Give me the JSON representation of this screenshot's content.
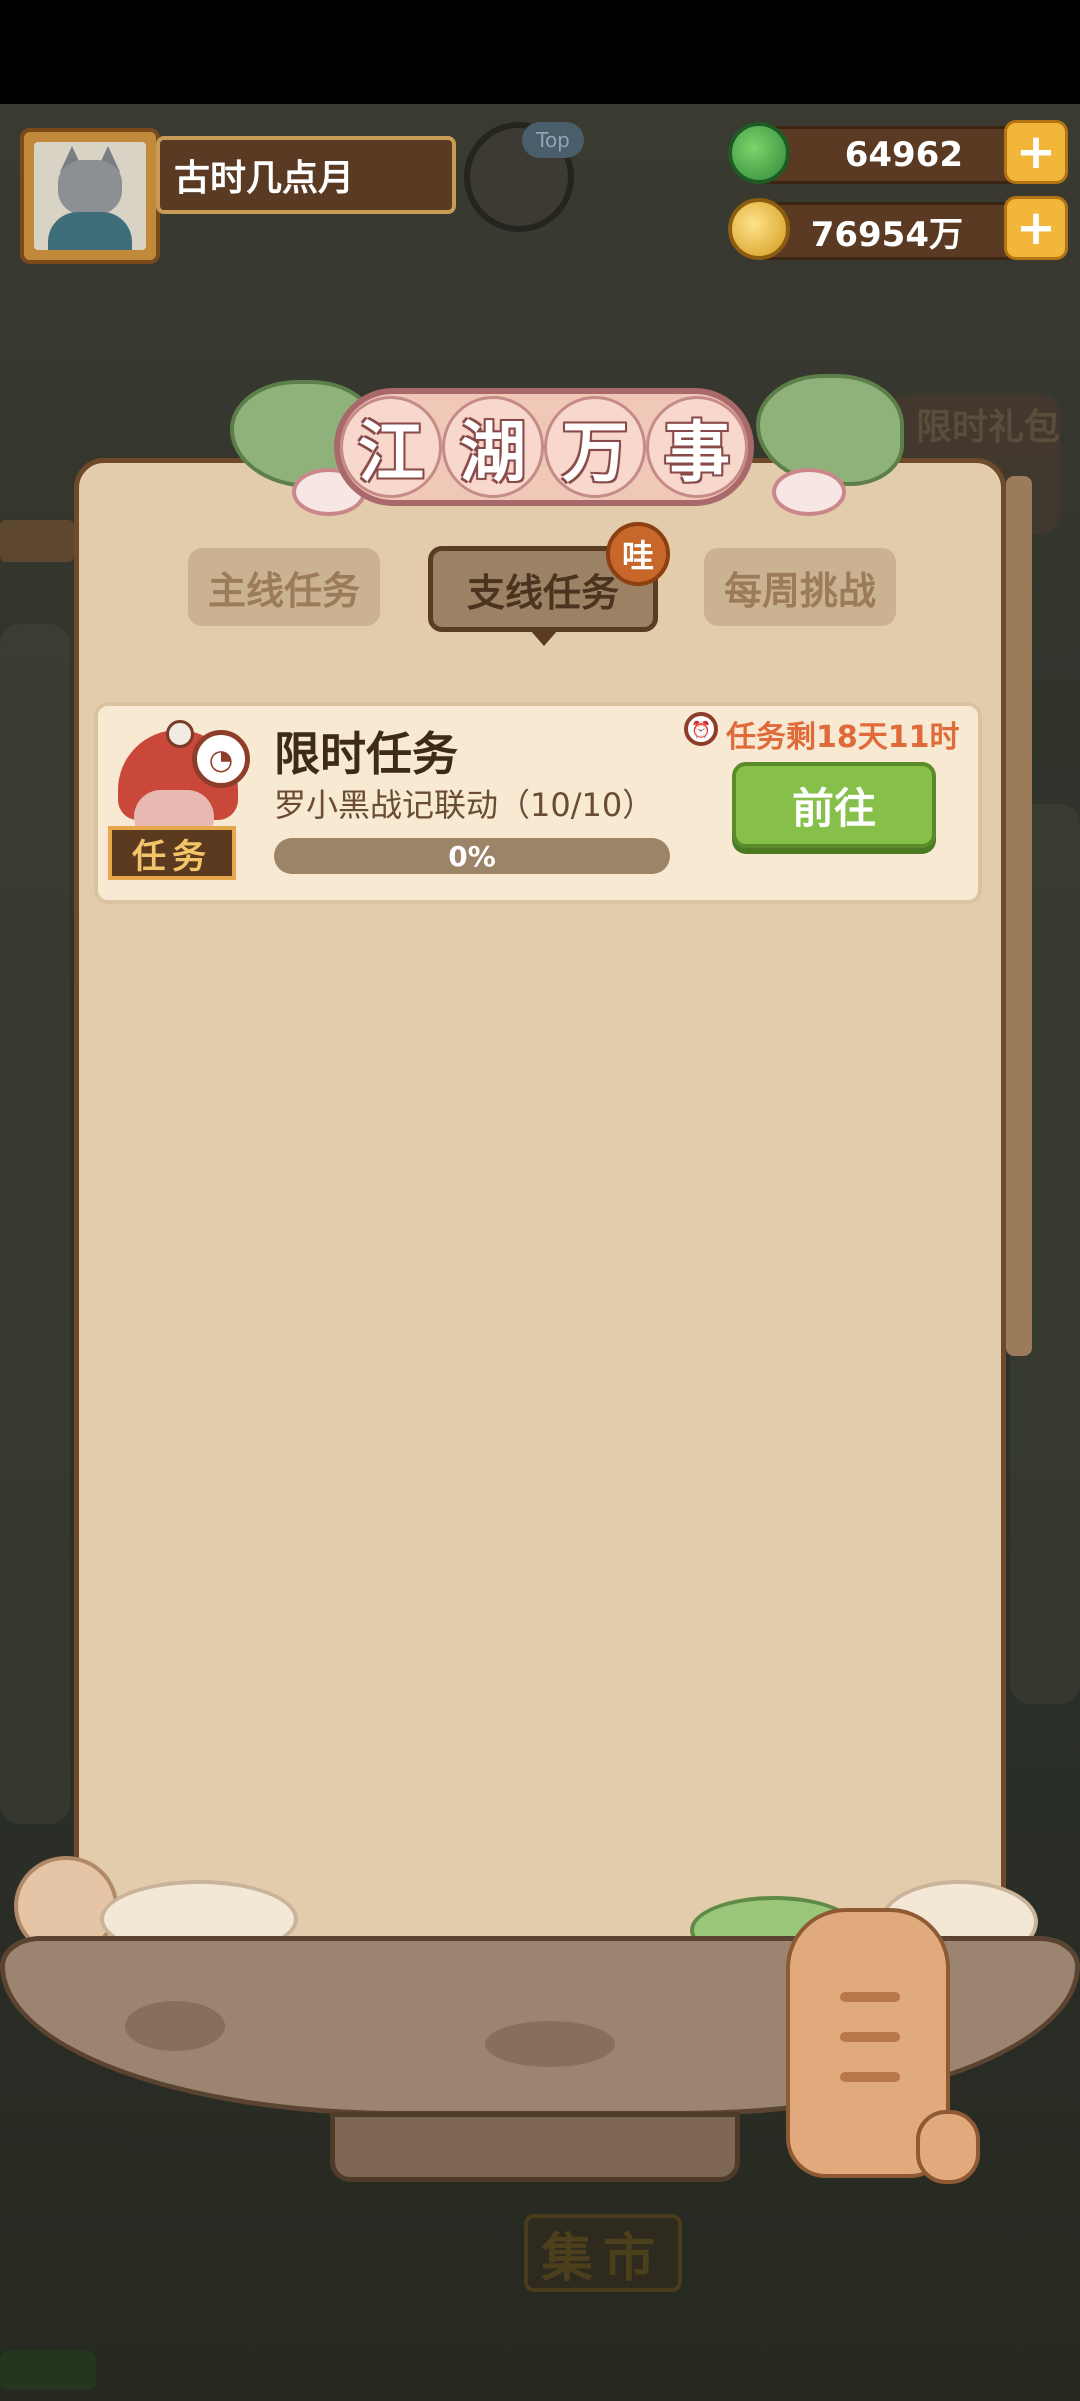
{
  "hud": {
    "player_name": "古时几点月",
    "top_badge": "Top",
    "resources": [
      {
        "icon": "jade-coin-icon",
        "value": "64962"
      },
      {
        "icon": "gold-coin-icon",
        "value": "76954万"
      }
    ],
    "plus_label": "+"
  },
  "background": {
    "gift_label": "限时礼包",
    "market_label": "集市"
  },
  "panel": {
    "title_chars": [
      "江",
      "湖",
      "万",
      "事"
    ],
    "tabs": [
      {
        "label": "主线任务",
        "active": false
      },
      {
        "label": "支线任务",
        "active": true
      },
      {
        "label": "每周挑战",
        "active": false
      }
    ],
    "active_tab_badge": "哇"
  },
  "task": {
    "tag": "任务",
    "title": "限时任务",
    "description": "罗小黑战记联动（10/10）",
    "progress": 0,
    "progress_text": "0%",
    "timer_text": "任务剩18天11时",
    "go_button": "前往"
  },
  "colors": {
    "accent_green": "#86bf4a",
    "timer_orange": "#e06b3a",
    "panel_bg": "#e2ccab"
  }
}
